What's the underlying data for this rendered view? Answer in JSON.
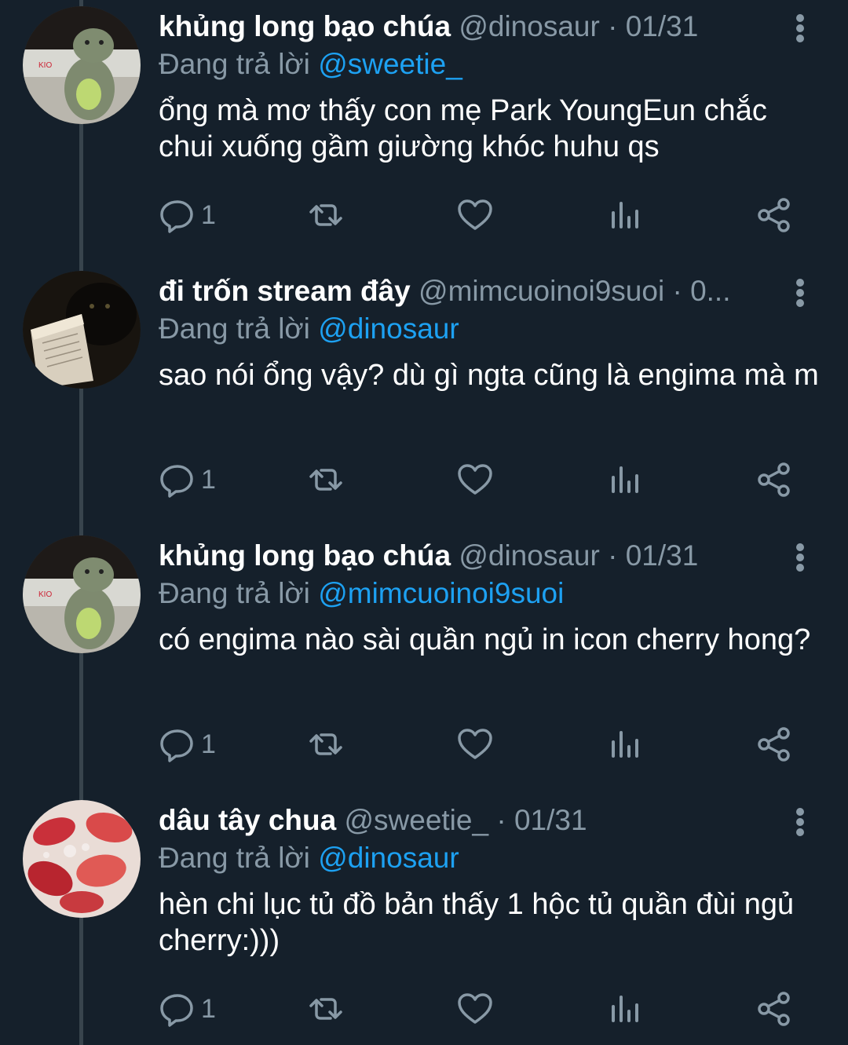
{
  "colors": {
    "background": "#15202b",
    "secondary_text": "#8899a6",
    "link": "#1da1f2",
    "thread_line": "#38444d"
  },
  "tweets": [
    {
      "display_name": "khủng long bạo chúa",
      "handle": "@dinosaur",
      "separator": "·",
      "date": "01/31",
      "reply_prefix": "Đang trả lời",
      "reply_target": "@sweetie_",
      "text": "ổng mà mơ thấy con mẹ Park YoungEun chắc chui xuống gầm giường khóc huhu qs",
      "reply_count": "1",
      "avatar": "dinosaur-plush-avatar"
    },
    {
      "display_name": "đi trốn stream đây",
      "handle": "@mimcuoinoi9suoi",
      "separator": "·",
      "date": "0...",
      "reply_prefix": "Đang trả lời",
      "reply_target": "@dinosaur",
      "text": "sao nói ổng vậy? dù gì ngta cũng là engima mà m",
      "reply_count": "1",
      "avatar": "black-cat-book-avatar"
    },
    {
      "display_name": "khủng long bạo chúa",
      "handle": "@dinosaur",
      "separator": "·",
      "date": "01/31",
      "reply_prefix": "Đang trả lời",
      "reply_target": "@mimcuoinoi9suoi",
      "text": "có engima nào sài quần ngủ in icon cherry hong?",
      "reply_count": "1",
      "avatar": "dinosaur-plush-avatar"
    },
    {
      "display_name": "dâu tây chua",
      "handle": "@sweetie_",
      "separator": "·",
      "date": "01/31",
      "reply_prefix": "Đang trả lời",
      "reply_target": "@dinosaur",
      "text": "hèn chi lục tủ đồ bản thấy 1 hộc tủ quần đùi ngủ cherry:)))",
      "reply_count": "1",
      "avatar": "strawberry-milk-avatar"
    }
  ]
}
